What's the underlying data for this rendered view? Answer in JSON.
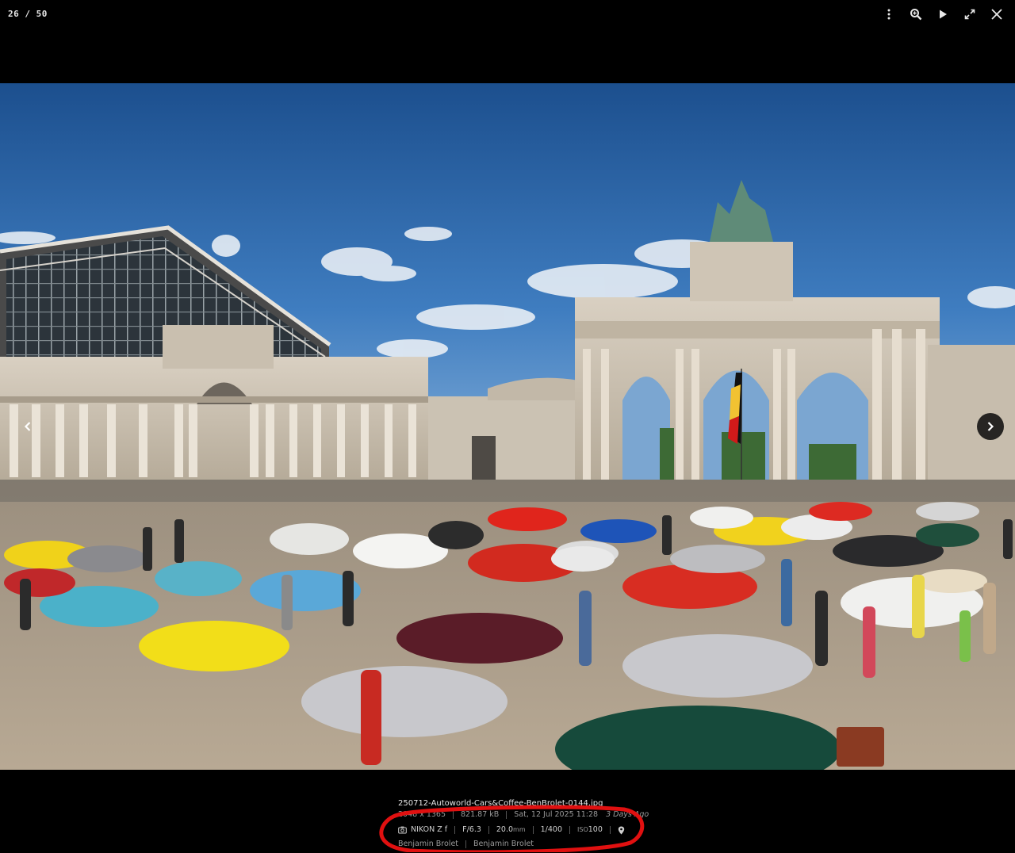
{
  "viewer": {
    "counter": "26 / 50",
    "toolbar": {
      "menu_icon": "more-vertical-icon",
      "zoom_icon": "zoom-icon",
      "play_icon": "play-icon",
      "fullscreen_icon": "fullscreen-icon",
      "close_icon": "close-icon"
    }
  },
  "caption": {
    "filename": "250712-Autoworld-Cars&Coffee-BenBrolet-0144.jpg",
    "dimensions": "2048 x 1365",
    "filesize": "821.87 kB",
    "date": "Sat, 12 Jul 2025 11:28",
    "relative_date": "3 Days Ago",
    "camera": "NIKON Z f",
    "aperture": "F/6.3",
    "focal_value": "20.0",
    "focal_unit": "mm",
    "shutter": "1/400",
    "iso_label": "ISO",
    "iso_value": "100",
    "artist": "Benjamin Brolet",
    "copyright": "Benjamin Brolet"
  },
  "colors": {
    "annotation": "#e01010",
    "sky": "#2a66a8"
  }
}
